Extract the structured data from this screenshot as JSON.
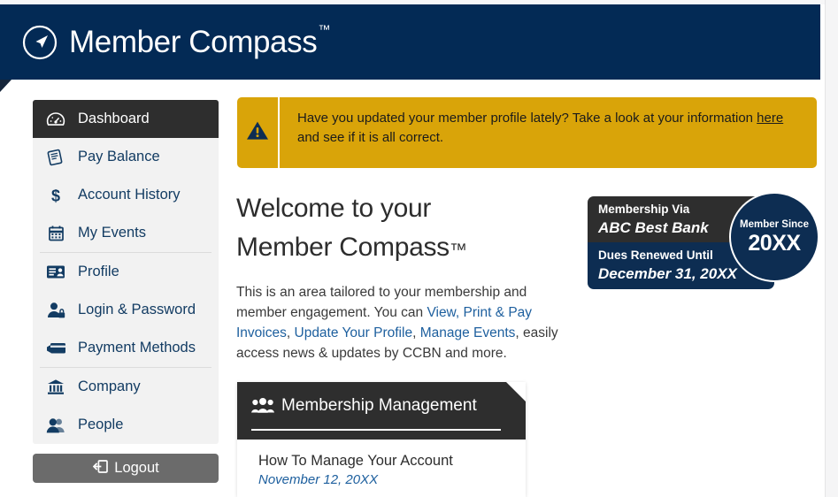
{
  "header": {
    "brand": "Member Compass",
    "trademark": "™",
    "logo_icon": "compass-arrow-icon",
    "background_color": "#032a55"
  },
  "sidebar": {
    "items": [
      {
        "label": "Dashboard",
        "icon": "gauge-icon",
        "active": true
      },
      {
        "label": "Pay Balance",
        "icon": "invoice-icon",
        "active": false
      },
      {
        "label": "Account History",
        "icon": "dollar-sign-icon",
        "active": false
      },
      {
        "label": "My Events",
        "icon": "calendar-icon",
        "active": false
      },
      {
        "label": "Profile",
        "icon": "id-card-icon",
        "active": false
      },
      {
        "label": "Login & Password",
        "icon": "user-lock-icon",
        "active": false
      },
      {
        "label": "Payment Methods",
        "icon": "credit-card-icon",
        "active": false
      },
      {
        "label": "Company",
        "icon": "bank-icon",
        "active": false
      },
      {
        "label": "People",
        "icon": "users-icon",
        "active": false
      }
    ],
    "logout": {
      "label": "Logout",
      "icon": "sign-out-icon",
      "color": "#6b6b6b"
    }
  },
  "alert": {
    "icon": "warning-triangle-icon",
    "background_color": "#d9a409",
    "text_before_link": "Have you updated your member profile lately? Take a look at your information ",
    "link_label": "here",
    "text_after_link": " and see if it is all correct."
  },
  "welcome": {
    "heading_line1": "Welcome to your",
    "heading_line2": "Member Compass",
    "heading_tm": "™",
    "paragraph_part1": "This is an area tailored to your membership and member engagement. You can ",
    "link1": "View, Print & Pay Invoices",
    "sep1": ", ",
    "link2": "Update Your Profile",
    "sep2": ", ",
    "link3": "Manage Events",
    "paragraph_part2": ", easily access news & updates by CCBN and more.",
    "link_color": "#1d5f9e"
  },
  "membership_badge": {
    "via_label": "Membership Via",
    "via_value": "ABC Best Bank",
    "dues_label": "Dues Renewed Until",
    "dues_value": "December 31, 20XX",
    "since_label": "Member Since",
    "since_value": "20XX",
    "top_color": "#2e2e2e",
    "bottom_color": "#0d2d52"
  },
  "membership_management": {
    "icon": "users-group-icon",
    "title": "Membership Management",
    "items": [
      {
        "title": "How To Manage Your Account",
        "date": "November 12, 20XX"
      }
    ]
  }
}
